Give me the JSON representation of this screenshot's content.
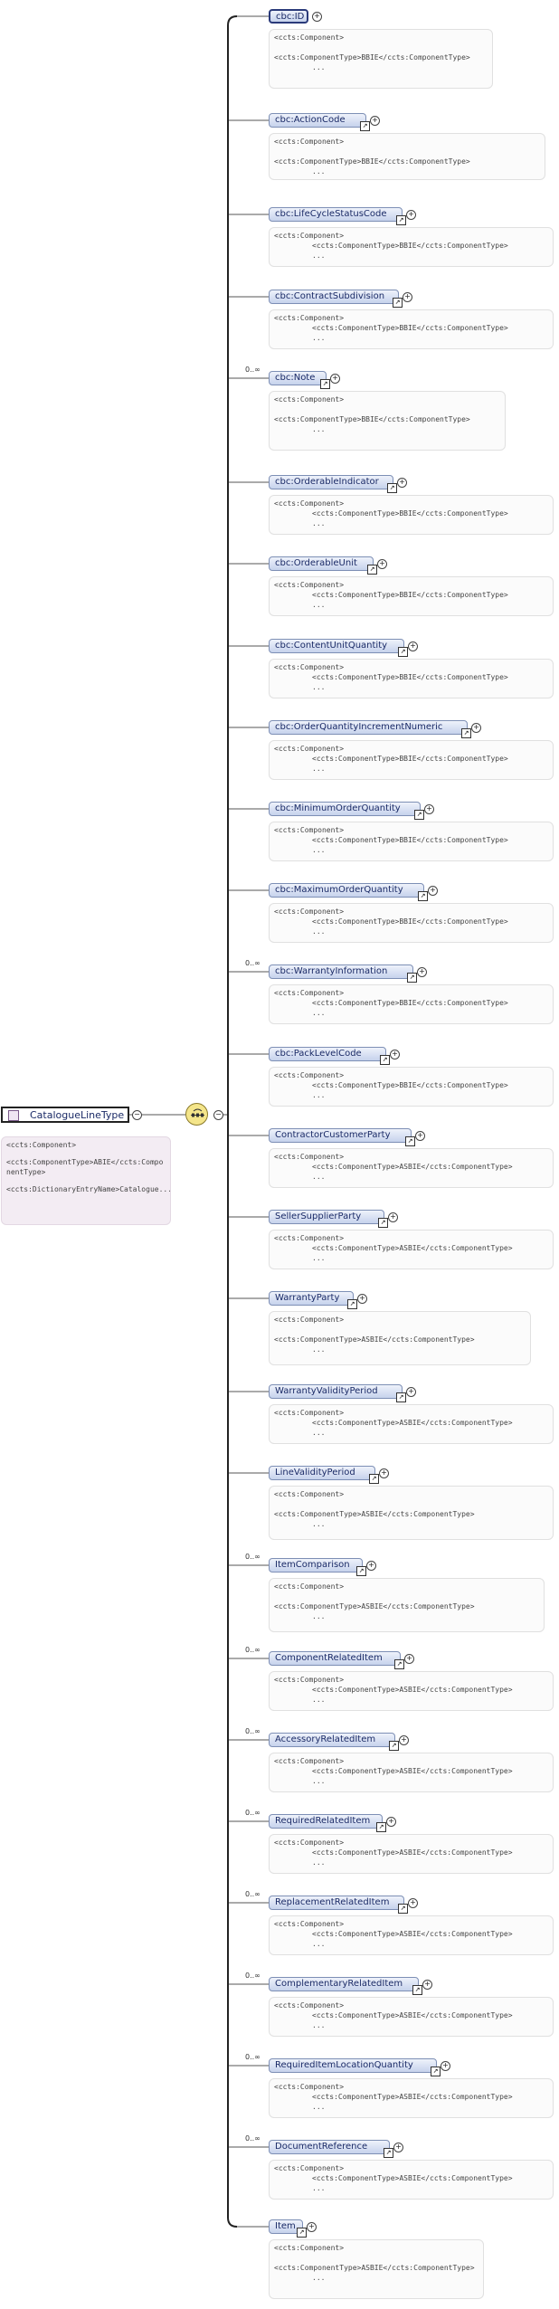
{
  "root": {
    "label": "CatalogueLineType",
    "card": [
      "<ccts:Component>",
      "<ccts:ComponentType>ABIE</ccts:ComponentType>",
      "<ccts:DictionaryEntryName>Catalogue..."
    ]
  },
  "card_open": "<ccts:Component>",
  "ellipsis": "...",
  "children": [
    {
      "label": "cbc:ID",
      "mult": "",
      "link": false,
      "sel": true,
      "type": "<ccts:ComponentType>BBIE</ccts:ComponentType>"
    },
    {
      "label": "cbc:ActionCode",
      "mult": "",
      "link": true,
      "type": "<ccts:ComponentType>BBIE</ccts:ComponentType>"
    },
    {
      "label": "cbc:LifeCycleStatusCode",
      "mult": "",
      "link": true,
      "type": "<ccts:ComponentType>BBIE</ccts:ComponentType>"
    },
    {
      "label": "cbc:ContractSubdivision",
      "mult": "",
      "link": true,
      "type": "<ccts:ComponentType>BBIE</ccts:ComponentType>"
    },
    {
      "label": "cbc:Note",
      "mult": "0..∞",
      "link": true,
      "type": "<ccts:ComponentType>BBIE</ccts:ComponentType>"
    },
    {
      "label": "cbc:OrderableIndicator",
      "mult": "",
      "link": true,
      "type": "<ccts:ComponentType>BBIE</ccts:ComponentType>"
    },
    {
      "label": "cbc:OrderableUnit",
      "mult": "",
      "link": true,
      "type": "<ccts:ComponentType>BBIE</ccts:ComponentType>"
    },
    {
      "label": "cbc:ContentUnitQuantity",
      "mult": "",
      "link": true,
      "type": "<ccts:ComponentType>BBIE</ccts:ComponentType>"
    },
    {
      "label": "cbc:OrderQuantityIncrementNumeric",
      "mult": "",
      "link": true,
      "type": "<ccts:ComponentType>BBIE</ccts:ComponentType>"
    },
    {
      "label": "cbc:MinimumOrderQuantity",
      "mult": "",
      "link": true,
      "type": "<ccts:ComponentType>BBIE</ccts:ComponentType>"
    },
    {
      "label": "cbc:MaximumOrderQuantity",
      "mult": "",
      "link": true,
      "type": "<ccts:ComponentType>BBIE</ccts:ComponentType>"
    },
    {
      "label": "cbc:WarrantyInformation",
      "mult": "0..∞",
      "link": true,
      "type": "<ccts:ComponentType>BBIE</ccts:ComponentType>"
    },
    {
      "label": "cbc:PackLevelCode",
      "mult": "",
      "link": true,
      "type": "<ccts:ComponentType>BBIE</ccts:ComponentType>"
    },
    {
      "label": "ContractorCustomerParty",
      "mult": "",
      "link": true,
      "type": "<ccts:ComponentType>ASBIE</ccts:ComponentType>"
    },
    {
      "label": "SellerSupplierParty",
      "mult": "",
      "link": true,
      "type": "<ccts:ComponentType>ASBIE</ccts:ComponentType>"
    },
    {
      "label": "WarrantyParty",
      "mult": "",
      "link": true,
      "type": "<ccts:ComponentType>ASBIE</ccts:ComponentType>"
    },
    {
      "label": "WarrantyValidityPeriod",
      "mult": "",
      "link": true,
      "type": "<ccts:ComponentType>ASBIE</ccts:ComponentType>"
    },
    {
      "label": "LineValidityPeriod",
      "mult": "",
      "link": true,
      "type": "<ccts:ComponentType>ASBIE</ccts:ComponentType>"
    },
    {
      "label": "ItemComparison",
      "mult": "0..∞",
      "link": true,
      "type": "<ccts:ComponentType>ASBIE</ccts:ComponentType>"
    },
    {
      "label": "ComponentRelatedItem",
      "mult": "0..∞",
      "link": true,
      "type": "<ccts:ComponentType>ASBIE</ccts:ComponentType>"
    },
    {
      "label": "AccessoryRelatedItem",
      "mult": "0..∞",
      "link": true,
      "type": "<ccts:ComponentType>ASBIE</ccts:ComponentType>"
    },
    {
      "label": "RequiredRelatedItem",
      "mult": "0..∞",
      "link": true,
      "type": "<ccts:ComponentType>ASBIE</ccts:ComponentType>"
    },
    {
      "label": "ReplacementRelatedItem",
      "mult": "0..∞",
      "link": true,
      "type": "<ccts:ComponentType>ASBIE</ccts:ComponentType>"
    },
    {
      "label": "ComplementaryRelatedItem",
      "mult": "0..∞",
      "link": true,
      "type": "<ccts:ComponentType>ASBIE</ccts:ComponentType>"
    },
    {
      "label": "RequiredItemLocationQuantity",
      "mult": "0..∞",
      "link": true,
      "type": "<ccts:ComponentType>ASBIE</ccts:ComponentType>"
    },
    {
      "label": "DocumentReference",
      "mult": "0..∞",
      "link": true,
      "type": "<ccts:ComponentType>ASBIE</ccts:ComponentType>"
    },
    {
      "label": "Item",
      "mult": "",
      "link": true,
      "type": "<ccts:ComponentType>ASBIE</ccts:ComponentType>"
    }
  ]
}
